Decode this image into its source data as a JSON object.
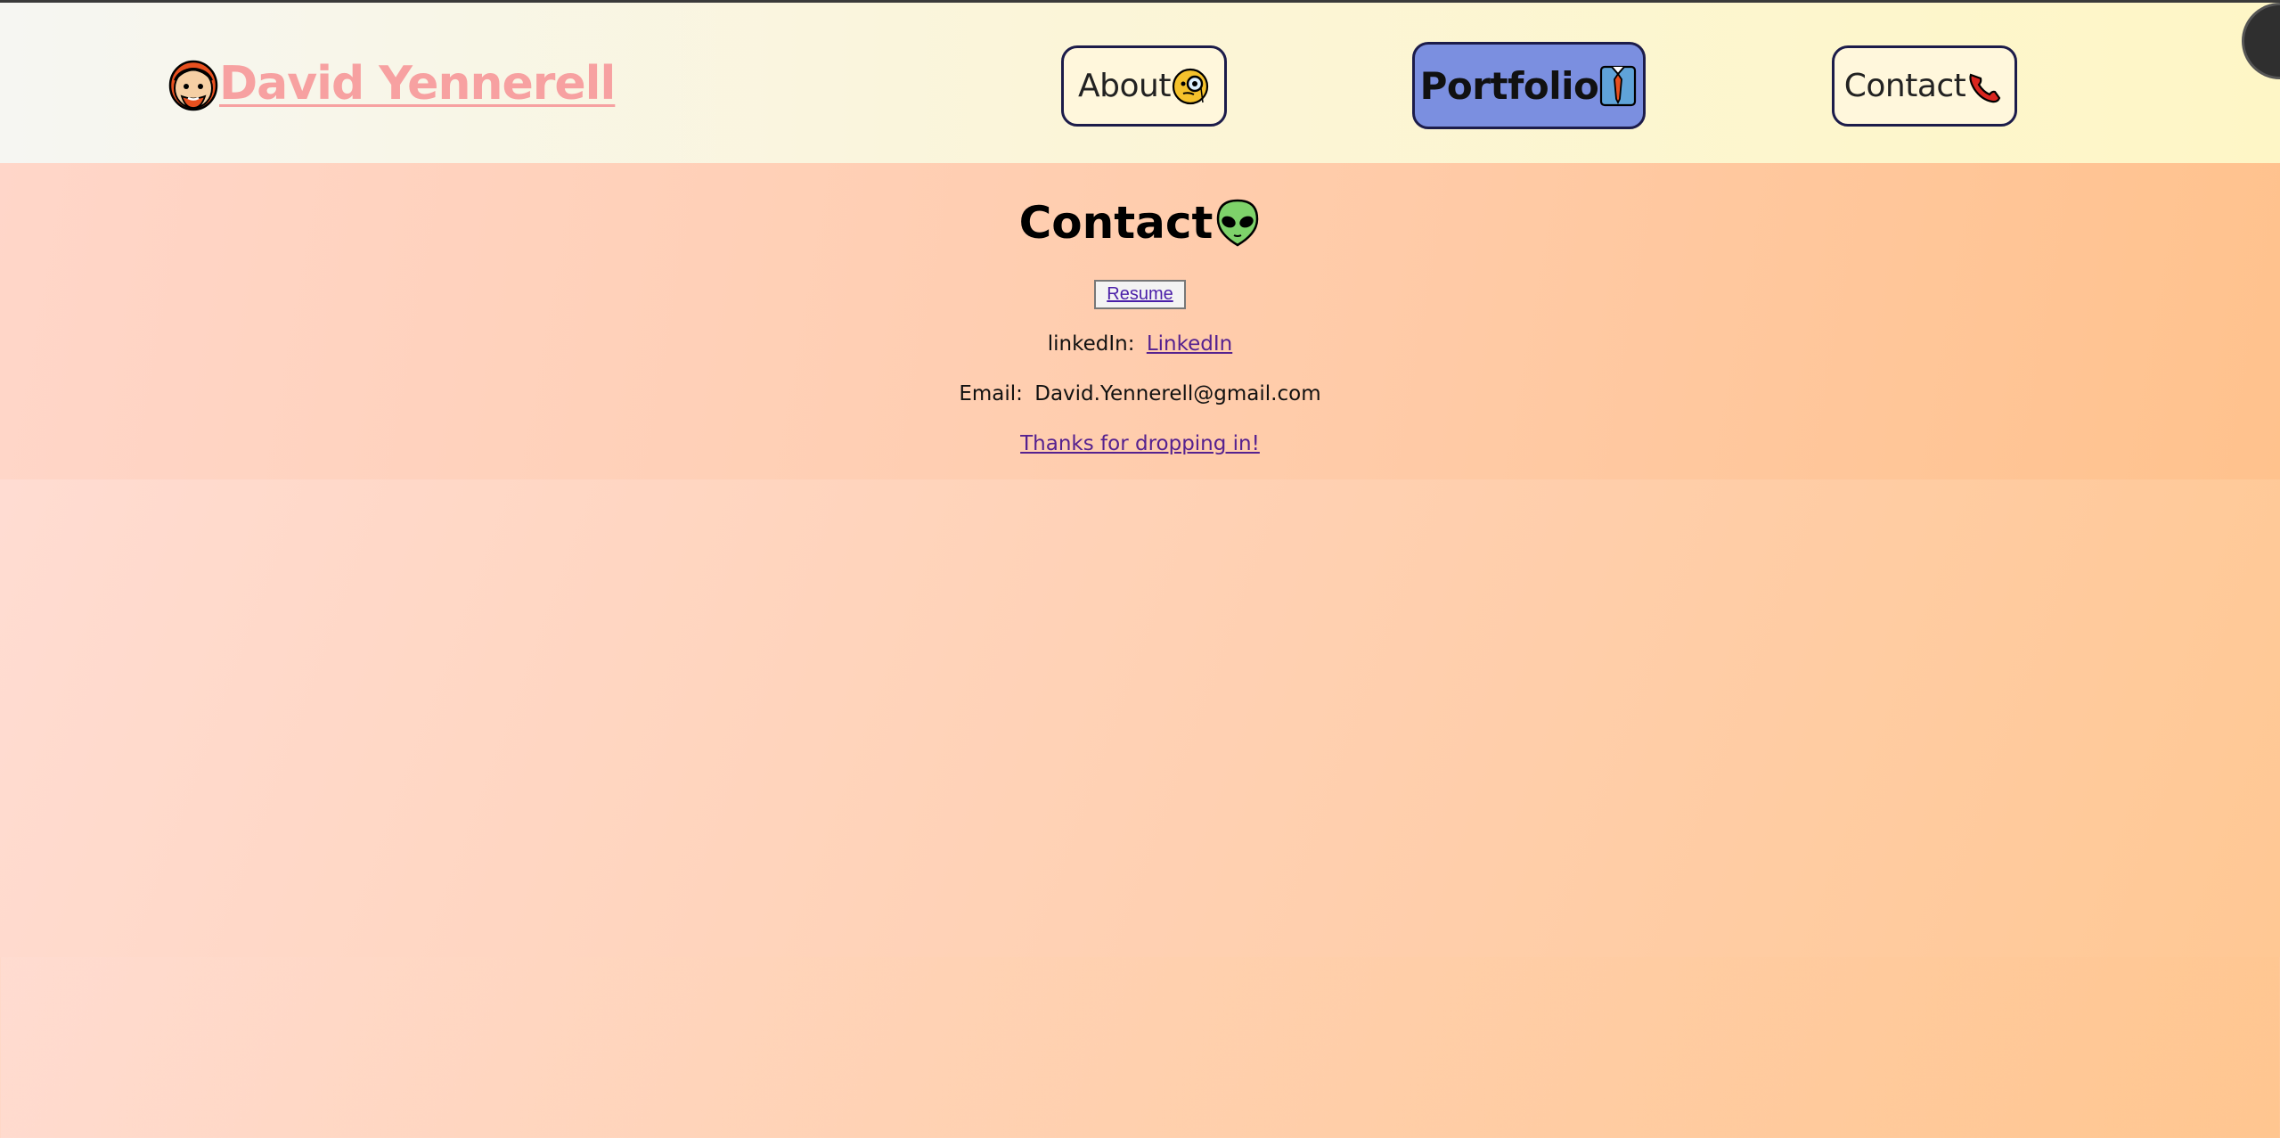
{
  "header": {
    "brand_name": "David Yennerell",
    "nav": [
      {
        "label": "About",
        "icon": "monocle-face-icon"
      },
      {
        "label": "Portfolio",
        "icon": "necktie-shirt-icon"
      },
      {
        "label": "Contact",
        "icon": "telephone-icon"
      }
    ],
    "active_nav": "Portfolio"
  },
  "contact": {
    "title": "Contact",
    "title_icon": "alien-icon",
    "resume_label": "Resume",
    "linkedin_prefix": "linkedIn:",
    "linkedin_link": "LinkedIn",
    "email_prefix": "Email:",
    "email_value": "David.Yennerell@gmail.com",
    "thanks_link": "Thanks for dropping in!"
  },
  "colors": {
    "brand": "#f7a1a1",
    "nav_border": "#1c1c4a",
    "active_nav_bg": "#7b8fe0",
    "link": "#55218f"
  }
}
